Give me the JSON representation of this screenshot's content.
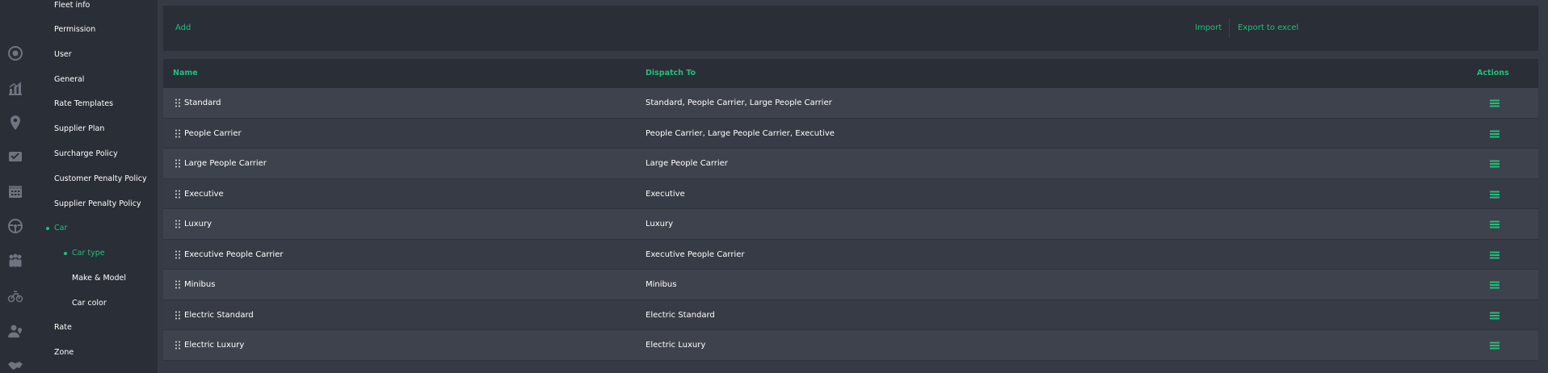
{
  "colors": {
    "accent": "#1fc07a",
    "panel": "#2a2e36",
    "row_odd": "#3e424c",
    "row_even": "#373b45"
  },
  "rail": {
    "icons": [
      "dashboard-icon",
      "analytics-icon",
      "location-pin-icon",
      "booking-icon",
      "calendar-icon",
      "steering-wheel-icon",
      "users-group-icon",
      "driver-icon",
      "map-user-icon",
      "handshake-icon"
    ]
  },
  "submenu": {
    "items": [
      {
        "label": "Fleet info"
      },
      {
        "label": "Permission"
      },
      {
        "label": "User"
      },
      {
        "label": "General"
      },
      {
        "label": "Rate Templates"
      },
      {
        "label": "Supplier Plan"
      },
      {
        "label": "Surcharge Policy"
      },
      {
        "label": "Customer Penalty Policy"
      },
      {
        "label": "Supplier Penalty Policy"
      },
      {
        "label": "Car"
      },
      {
        "label": "Car type"
      },
      {
        "label": "Make & Model"
      },
      {
        "label": "Car color"
      },
      {
        "label": "Rate"
      },
      {
        "label": "Zone"
      }
    ]
  },
  "toolbar": {
    "add_label": "Add",
    "import_label": "Import",
    "export_label": "Export to excel"
  },
  "table": {
    "columns": {
      "name": "Name",
      "dispatch": "Dispatch To",
      "actions": "Actions"
    },
    "rows": [
      {
        "name": "Standard",
        "dispatch": "Standard, People Carrier, Large People Carrier"
      },
      {
        "name": "People Carrier",
        "dispatch": "People Carrier, Large People Carrier, Executive"
      },
      {
        "name": "Large People Carrier",
        "dispatch": "Large People Carrier"
      },
      {
        "name": "Executive",
        "dispatch": "Executive"
      },
      {
        "name": "Luxury",
        "dispatch": "Luxury"
      },
      {
        "name": "Executive People Carrier",
        "dispatch": "Executive People Carrier"
      },
      {
        "name": "Minibus",
        "dispatch": "Minibus"
      },
      {
        "name": "Electric Standard",
        "dispatch": "Electric Standard"
      },
      {
        "name": "Electric Luxury",
        "dispatch": "Electric Luxury"
      }
    ]
  }
}
